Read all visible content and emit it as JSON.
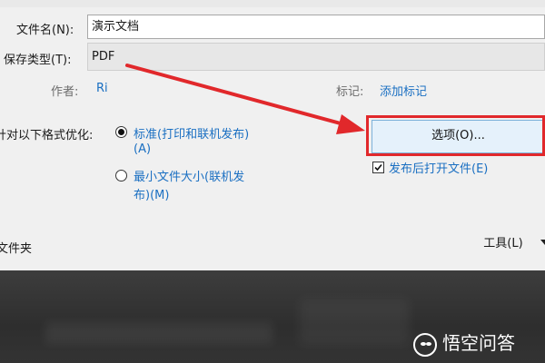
{
  "dialog": {
    "filename_label": "文件名(N):",
    "filename_value": "演示文档",
    "filetype_label": "保存类型(T):",
    "filetype_value": "PDF",
    "author_label": "作者:",
    "author_value": "Ri",
    "tags_label": "标记:",
    "tags_link": "添加标记",
    "optimize_label": "针对以下格式优化:",
    "radio_standard_line1": "标准(打印和联机发布)",
    "radio_standard_line2": "(A)",
    "radio_minimum_line1": "最小文件大小(联机发",
    "radio_minimum_line2": "布)(M)",
    "options_button": "选项(O)...",
    "open_after_publish": "发布后打开文件(E)",
    "folder_label": "文件夹",
    "tools_button": "工具(L)"
  },
  "watermark": {
    "text": "悟空问答"
  },
  "colors": {
    "highlight_box": "#e1282b",
    "link": "#1a6fc2",
    "arrow": "#e1282b"
  }
}
